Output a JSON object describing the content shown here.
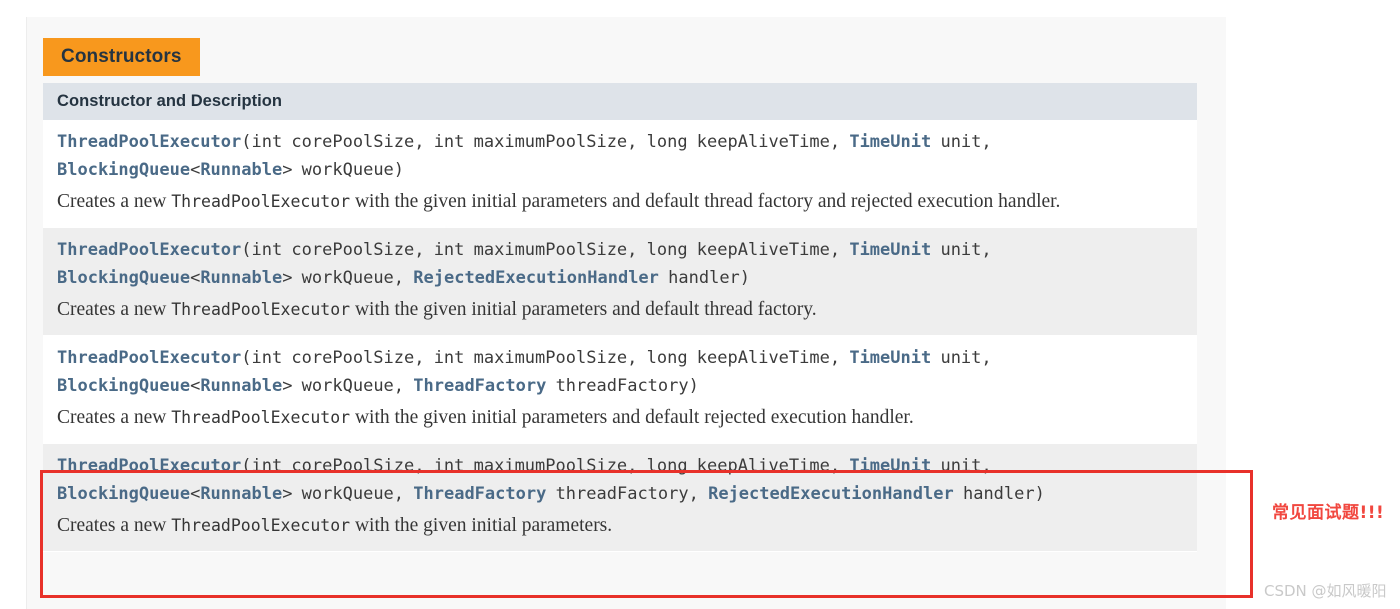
{
  "panel": {
    "tab_label": "Constructors",
    "column_header": "Constructor and Description"
  },
  "colors": {
    "tab_background": "#f8981d",
    "header_background": "#dee3e9",
    "link_text": "#4a6a87",
    "highlight_border": "#e8312a",
    "annotation_text": "#f1473f",
    "watermark_text": "#c9c9c9",
    "row_white": "#ffffff",
    "row_gray": "#eeeeee",
    "panel_background": "#f8f8f8"
  },
  "constructors": [
    {
      "signature_parts": [
        {
          "text": "ThreadPoolExecutor",
          "kind": "link"
        },
        {
          "text": "(int corePoolSize, int maximumPoolSize, long keepAliveTime, ",
          "kind": "plain"
        },
        {
          "text": "TimeUnit",
          "kind": "link"
        },
        {
          "text": " unit, ",
          "kind": "plain"
        },
        {
          "text": "BlockingQueue",
          "kind": "link"
        },
        {
          "text": "<",
          "kind": "plain"
        },
        {
          "text": "Runnable",
          "kind": "link"
        },
        {
          "text": "> workQueue)",
          "kind": "plain"
        }
      ],
      "description_before": "Creates a new ",
      "description_code": "ThreadPoolExecutor",
      "description_after": " with the given initial parameters and default thread factory and rejected execution handler.",
      "row_style": "white",
      "highlighted": false
    },
    {
      "signature_parts": [
        {
          "text": "ThreadPoolExecutor",
          "kind": "link"
        },
        {
          "text": "(int corePoolSize, int maximumPoolSize, long keepAliveTime, ",
          "kind": "plain"
        },
        {
          "text": "TimeUnit",
          "kind": "link"
        },
        {
          "text": " unit, ",
          "kind": "plain"
        },
        {
          "text": "BlockingQueue",
          "kind": "link"
        },
        {
          "text": "<",
          "kind": "plain"
        },
        {
          "text": "Runnable",
          "kind": "link"
        },
        {
          "text": "> workQueue, ",
          "kind": "plain"
        },
        {
          "text": "RejectedExecutionHandler",
          "kind": "link"
        },
        {
          "text": " handler)",
          "kind": "plain"
        }
      ],
      "description_before": "Creates a new ",
      "description_code": "ThreadPoolExecutor",
      "description_after": " with the given initial parameters and default thread factory.",
      "row_style": "gray",
      "highlighted": false
    },
    {
      "signature_parts": [
        {
          "text": "ThreadPoolExecutor",
          "kind": "link"
        },
        {
          "text": "(int corePoolSize, int maximumPoolSize, long keepAliveTime, ",
          "kind": "plain"
        },
        {
          "text": "TimeUnit",
          "kind": "link"
        },
        {
          "text": " unit, ",
          "kind": "plain"
        },
        {
          "text": "BlockingQueue",
          "kind": "link"
        },
        {
          "text": "<",
          "kind": "plain"
        },
        {
          "text": "Runnable",
          "kind": "link"
        },
        {
          "text": "> workQueue, ",
          "kind": "plain"
        },
        {
          "text": "ThreadFactory",
          "kind": "link"
        },
        {
          "text": " threadFactory)",
          "kind": "plain"
        }
      ],
      "description_before": "Creates a new ",
      "description_code": "ThreadPoolExecutor",
      "description_after": " with the given initial parameters and default rejected execution handler.",
      "row_style": "white",
      "highlighted": false
    },
    {
      "signature_parts": [
        {
          "text": "ThreadPoolExecutor",
          "kind": "link"
        },
        {
          "text": "(int corePoolSize, int maximumPoolSize, long keepAliveTime, ",
          "kind": "plain"
        },
        {
          "text": "TimeUnit",
          "kind": "link"
        },
        {
          "text": " unit, ",
          "kind": "plain"
        },
        {
          "text": "BlockingQueue",
          "kind": "link"
        },
        {
          "text": "<",
          "kind": "plain"
        },
        {
          "text": "Runnable",
          "kind": "link"
        },
        {
          "text": "> workQueue, ",
          "kind": "plain"
        },
        {
          "text": "ThreadFactory",
          "kind": "link"
        },
        {
          "text": " threadFactory, ",
          "kind": "plain"
        },
        {
          "text": "RejectedExecutionHandler",
          "kind": "link"
        },
        {
          "text": " handler)",
          "kind": "plain"
        }
      ],
      "description_before": "Creates a new ",
      "description_code": "ThreadPoolExecutor",
      "description_after": " with the given initial parameters.",
      "row_style": "gray",
      "highlighted": true
    }
  ],
  "annotation": {
    "text": "常见面试题!!!"
  },
  "watermark": {
    "text": "CSDN @如风暖阳"
  }
}
